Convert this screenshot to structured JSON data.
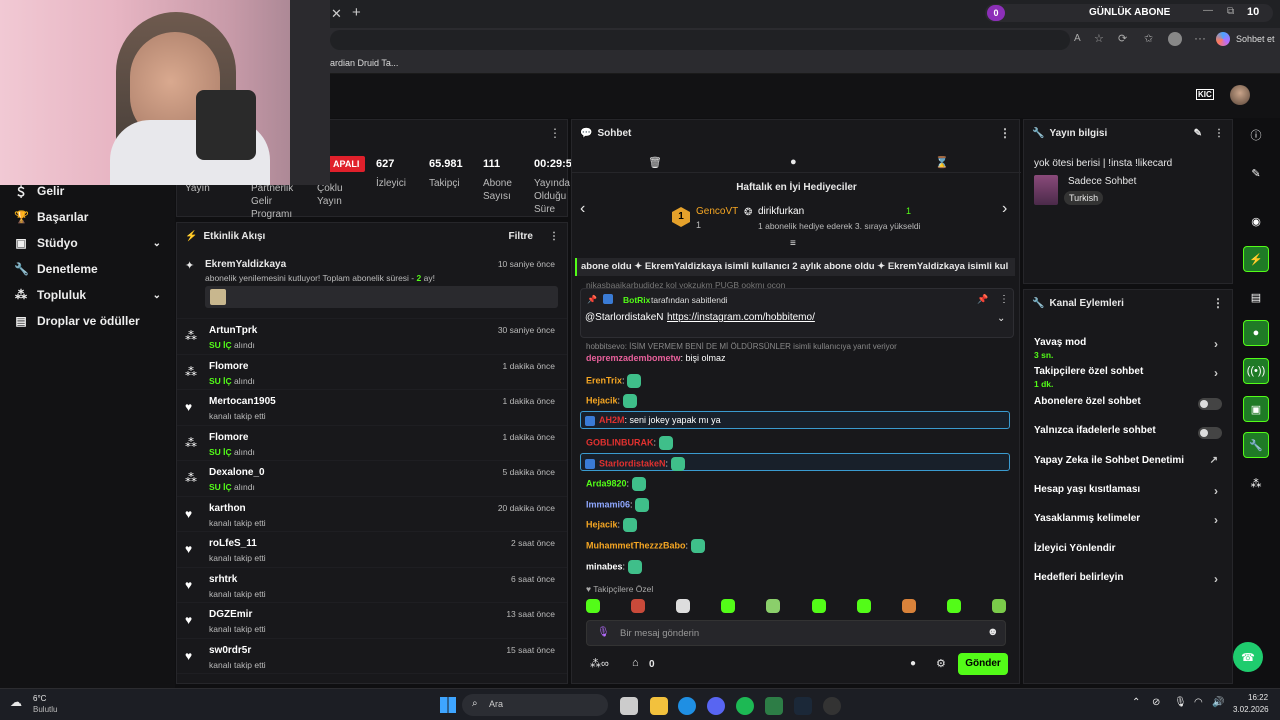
{
  "browser": {
    "goal_badge": "0",
    "goal_title": "GÜNLÜK ABONE",
    "goal_count": "10",
    "bookmark": "ardian Druid Ta...",
    "sohbet_btn": "Sohbet et"
  },
  "sidebar": {
    "items": [
      {
        "label": "Gelir",
        "icon": "money-icon"
      },
      {
        "label": "Başarılar",
        "icon": "trophy-icon"
      },
      {
        "label": "Stüdyo",
        "icon": "studio-icon"
      },
      {
        "label": "Denetleme",
        "icon": "wrench-icon"
      },
      {
        "label": "Topluluk",
        "icon": "community-icon"
      },
      {
        "label": "Droplar ve ödüller",
        "icon": "drops-icon"
      }
    ]
  },
  "stats": {
    "status_badge": "APALI",
    "items": [
      {
        "value": "",
        "label": "Yayın"
      },
      {
        "value": "",
        "label": "Partnerlik Gelir Programı"
      },
      {
        "value": "",
        "label": "Çoklu Yayın"
      },
      {
        "value": "627",
        "label": "İzleyici"
      },
      {
        "value": "65.981",
        "label": "Takipçi"
      },
      {
        "value": "111",
        "label": "Abone Sayısı"
      },
      {
        "value": "00:29:5",
        "label": "Yayında Olduğu Süre"
      }
    ]
  },
  "activity": {
    "title": "Etkinlik Akışı",
    "filter": "Filtre",
    "first": {
      "name": "EkremYaldizkaya",
      "text_a": "abonelik yenilemesini kutluyor! Toplam abonelik süresi - ",
      "text_b": "2",
      "text_c": " ay!",
      "time": "10 saniye önce"
    },
    "events": [
      {
        "name": "ArtunTprk",
        "hi": "SU İÇ",
        "rest": " alındı",
        "time": "30 saniye önce",
        "icon": "gift-icon"
      },
      {
        "name": "Flomore",
        "hi": "SU İÇ",
        "rest": " alındı",
        "time": "1 dakika önce",
        "icon": "gift-icon"
      },
      {
        "name": "Mertocan1905",
        "hi": "",
        "rest": "kanalı takip etti",
        "time": "1 dakika önce",
        "icon": "heart-icon"
      },
      {
        "name": "Flomore",
        "hi": "SU İÇ",
        "rest": " alındı",
        "time": "1 dakika önce",
        "icon": "gift-icon"
      },
      {
        "name": "Dexalone_0",
        "hi": "SU İÇ",
        "rest": " alındı",
        "time": "5 dakika önce",
        "icon": "gift-icon"
      },
      {
        "name": "karthon",
        "hi": "",
        "rest": "kanalı takip etti",
        "time": "20 dakika önce",
        "icon": "heart-icon"
      },
      {
        "name": "roLfeS_11",
        "hi": "",
        "rest": "kanalı takip etti",
        "time": "2 saat önce",
        "icon": "heart-icon"
      },
      {
        "name": "srhtrk",
        "hi": "",
        "rest": "kanalı takip etti",
        "time": "6 saat önce",
        "icon": "heart-icon"
      },
      {
        "name": "DGZEmir",
        "hi": "",
        "rest": "kanalı takip etti",
        "time": "13 saat önce",
        "icon": "heart-icon"
      },
      {
        "name": "sw0rdr5r",
        "hi": "",
        "rest": "kanalı takip etti",
        "time": "15 saat önce",
        "icon": "heart-icon"
      }
    ]
  },
  "chat": {
    "title": "Sohbet",
    "gifters_title": "Haftalık en İyi Hediyeciler",
    "gifter1_name": "GencoVT",
    "gifter1_count": "1",
    "gifter2_name": "dirikfurkan",
    "gifter2_count": "1",
    "gifter2_note": "1 abonelik hediye ederek 3. sıraya yükseldi",
    "ticker": "abone oldu ✦ EkremYaldizkaya isimli kullanıcı 2 aylık abone oldu ✦ EkremYaldizkaya isimli kul",
    "ticker_under": "nikasbaaikarbudidez kol yokzukm PUGB ookmı ocon",
    "pinned_by": "BotRix",
    "pinned_by_suffix": "tarafından sabitlendi",
    "pinned_user": "@StarlordistakeN",
    "pinned_link": "https://instagram.com/hobbitemo/",
    "reply_line": "hobbitsevo: İSİM VERMEM BENİ DE Mİ ÖLDÜRSÜNLER isimli kullanıcıya yanıt veriyor",
    "messages": [
      {
        "user": "depremzadembometw",
        "text": "bişi olmaz",
        "color": "#e8609b"
      },
      {
        "user": "ErenTrix",
        "text": "",
        "color": "#f5a623"
      },
      {
        "user": "Hejacik",
        "text": "",
        "color": "#f5a623"
      },
      {
        "user": "AH2M",
        "text": "seni jokey yapak mı ya",
        "color": "#e0312f"
      },
      {
        "user": "GOBLINBURAK",
        "text": "",
        "color": "#e0312f"
      },
      {
        "user": "StarlordistakeN",
        "text": "",
        "color": "#e0312f"
      },
      {
        "user": "Arda9820",
        "text": "",
        "color": "#53fc18"
      },
      {
        "user": "Immami06",
        "text": "",
        "color": "#8fa8ff"
      },
      {
        "user": "Hejacik",
        "text": "",
        "color": "#f5a623"
      },
      {
        "user": "MuhammetThezzzBabo",
        "text": "",
        "color": "#f5a623"
      },
      {
        "user": "minabes",
        "text": "",
        "color": "#ffffff"
      }
    ],
    "followers_only": "Takipçilere Özel",
    "input_placeholder": "Bir mesaj gönderin",
    "points": "0",
    "send": "Gönder"
  },
  "info": {
    "title": "Yayın bilgisi",
    "stream_title": "yok ötesi berisi | !insta !likecard",
    "category": "Sadece Sohbet",
    "tag": "Turkish"
  },
  "channel_actions": {
    "title": "Kanal Eylemleri",
    "items": [
      {
        "label": "Yavaş mod",
        "sub": "3 sn.",
        "kind": "chevron"
      },
      {
        "label": "Takipçilere özel sohbet",
        "sub": "1 dk.",
        "kind": "chevron"
      },
      {
        "label": "Abonelere özel sohbet",
        "sub": "",
        "kind": "toggle"
      },
      {
        "label": "Yalnızca ifadelerle sohbet",
        "sub": "",
        "kind": "toggle"
      },
      {
        "label": "Yapay Zeka ile Sohbet Denetimi",
        "sub": "",
        "kind": "external"
      },
      {
        "label": "Hesap yaşı kısıtlaması",
        "sub": "",
        "kind": "chevron"
      },
      {
        "label": "Yasaklanmış kelimeler",
        "sub": "",
        "kind": "chevron"
      },
      {
        "label": "İzleyici Yönlendir",
        "sub": "",
        "kind": "none"
      },
      {
        "label": "Hedefleri belirleyin",
        "sub": "",
        "kind": "chevron"
      }
    ]
  },
  "taskbar": {
    "temp": "6°C",
    "weather": "Bulutlu",
    "search": "Ara",
    "time": "16:22",
    "date": "3.02.2026"
  }
}
